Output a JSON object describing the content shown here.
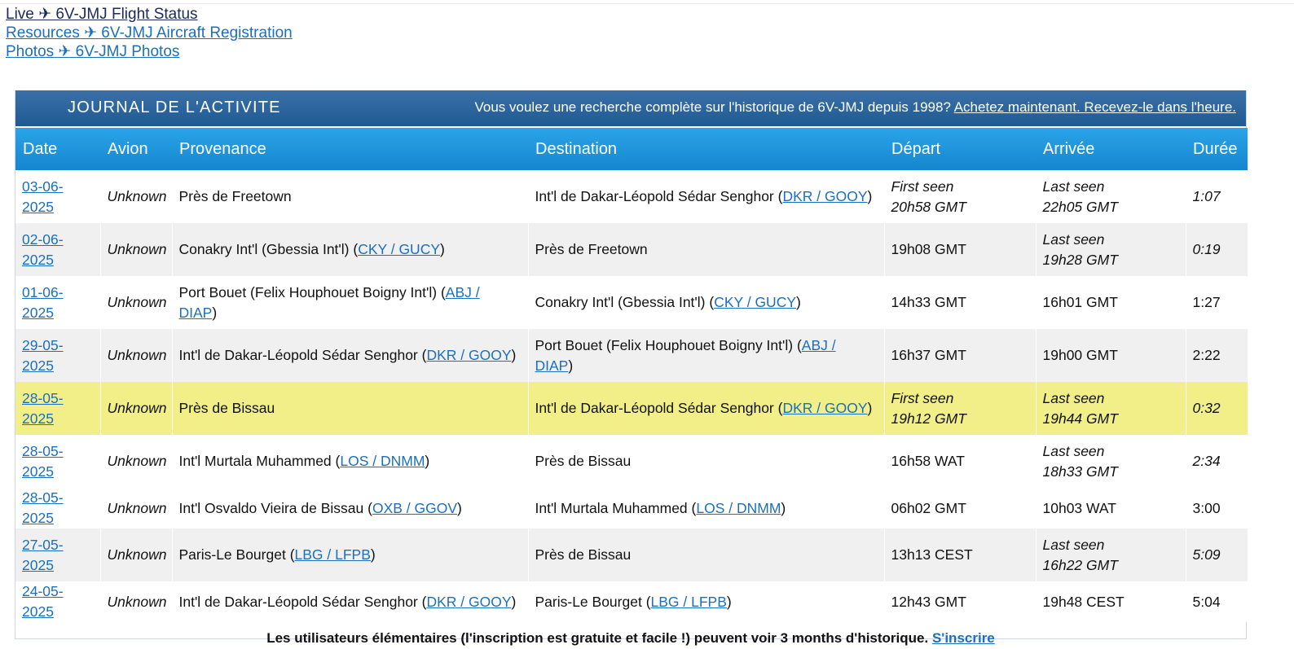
{
  "top_links": {
    "live": "Live ✈ 6V-JMJ Flight Status",
    "resources": "Resources ✈ 6V-JMJ Aircraft Registration",
    "photos": "Photos ✈ 6V-JMJ Photos"
  },
  "panel": {
    "title": "JOURNAL DE L'ACTIVITE",
    "promo_text": "Vous voulez une recherche complète sur l'historique de 6V-JMJ depuis 1998?",
    "promo_link": "Achetez maintenant. Recevez-le dans l'heure."
  },
  "columns": {
    "date": "Date",
    "avion": "Avion",
    "provenance": "Provenance",
    "destination": "Destination",
    "depart": "Départ",
    "arrivee": "Arrivée",
    "duree": "Durée"
  },
  "rows": [
    {
      "date": "03-06-2025",
      "avion": "Unknown",
      "prov_text": "Près de Freetown",
      "prov_code": "",
      "dest_text": "Int'l de Dakar-Léopold Sédar Senghor",
      "dest_code": "DKR / GOOY",
      "dep_label": "First seen",
      "dep_time": "20h58 GMT",
      "arr_label": "Last seen",
      "arr_time": "22h05 GMT",
      "duration": "1:07"
    },
    {
      "date": "02-06-2025",
      "avion": "Unknown",
      "prov_text": "Conakry Int'l (Gbessia Int'l)",
      "prov_code": "CKY / GUCY",
      "dest_text": "Près de Freetown",
      "dest_code": "",
      "dep_label": "",
      "dep_time": "19h08 GMT",
      "arr_label": "Last seen",
      "arr_time": "19h28 GMT",
      "duration": "0:19"
    },
    {
      "date": "01-06-2025",
      "avion": "Unknown",
      "prov_text": "Port Bouet (Felix Houphouet Boigny Int'l)",
      "prov_code": "ABJ / DIAP",
      "dest_text": "Conakry Int'l (Gbessia Int'l)",
      "dest_code": "CKY / GUCY",
      "dep_label": "",
      "dep_time": "14h33 GMT",
      "arr_label": "",
      "arr_time": "16h01 GMT",
      "duration": "1:27"
    },
    {
      "date": "29-05-2025",
      "avion": "Unknown",
      "prov_text": "Int'l de Dakar-Léopold Sédar Senghor",
      "prov_code": "DKR / GOOY",
      "dest_text": "Port Bouet (Felix Houphouet Boigny Int'l)",
      "dest_code": "ABJ / DIAP",
      "dep_label": "",
      "dep_time": "16h37 GMT",
      "arr_label": "",
      "arr_time": "19h00 GMT",
      "duration": "2:22"
    },
    {
      "date": "28-05-2025",
      "avion": "Unknown",
      "prov_text": "Près de Bissau",
      "prov_code": "",
      "dest_text": "Int'l de Dakar-Léopold Sédar Senghor",
      "dest_code": "DKR / GOOY",
      "dep_label": "First seen",
      "dep_time": "19h12 GMT",
      "arr_label": "Last seen",
      "arr_time": "19h44 GMT",
      "duration": "0:32"
    },
    {
      "date": "28-05-2025",
      "avion": "Unknown",
      "prov_text": "Int'l Murtala Muhammed",
      "prov_code": "LOS / DNMM",
      "dest_text": "Près de Bissau",
      "dest_code": "",
      "dep_label": "",
      "dep_time": "16h58 WAT",
      "arr_label": "Last seen",
      "arr_time": "18h33 GMT",
      "duration": "2:34"
    },
    {
      "date": "28-05-2025",
      "avion": "Unknown",
      "prov_text": "Int'l Osvaldo Vieira de Bissau",
      "prov_code": "OXB / GGOV",
      "dest_text": "Int'l Murtala Muhammed",
      "dest_code": "LOS / DNMM",
      "dep_label": "",
      "dep_time": "06h02 GMT",
      "arr_label": "",
      "arr_time": "10h03 WAT",
      "duration": "3:00"
    },
    {
      "date": "27-05-2025",
      "avion": "Unknown",
      "prov_text": "Paris-Le Bourget",
      "prov_code": "LBG / LFPB",
      "dest_text": "Près de Bissau",
      "dest_code": "",
      "dep_label": "",
      "dep_time": "13h13 CEST",
      "arr_label": "Last seen",
      "arr_time": "16h22 GMT",
      "duration": "5:09"
    },
    {
      "date": "24-05-2025",
      "avion": "Unknown",
      "prov_text": "Int'l de Dakar-Léopold Sédar Senghor",
      "prov_code": "DKR / GOOY",
      "dest_text": "Paris-Le Bourget",
      "dest_code": "LBG / LFPB",
      "dep_label": "",
      "dep_time": "12h43 GMT",
      "arr_label": "",
      "arr_time": "19h48 CEST",
      "duration": "5:04"
    }
  ],
  "footer": {
    "note": "Les utilisateurs élémentaires (l'inscription est gratuite et facile !) peuvent voir 3 months d'historique.",
    "signup": "S'inscrire"
  },
  "colors": {
    "header_blue": "#1f5a92",
    "column_header_blue": "#1586cf",
    "highlight_row": "#f2ee88",
    "link": "#1a6fbf"
  }
}
